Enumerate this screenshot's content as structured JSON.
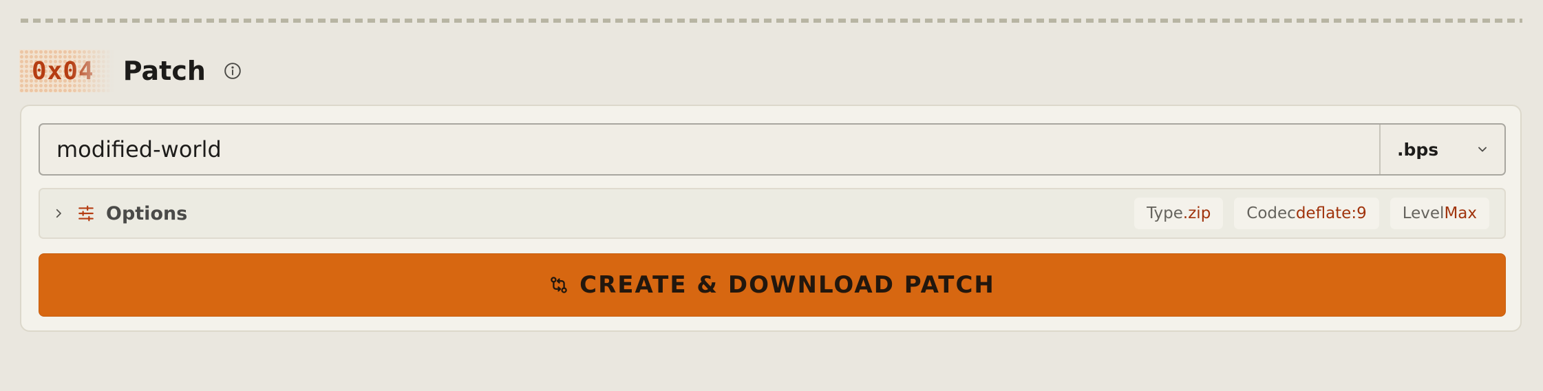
{
  "step": {
    "number": "0x04",
    "title": "Patch"
  },
  "patch_name": {
    "value": "modified-world",
    "format": ".bps",
    "format_options": [
      ".bps"
    ]
  },
  "options": {
    "label": "Options",
    "chips": [
      {
        "key": "Type",
        "value": ".zip"
      },
      {
        "key": "Codec",
        "value": "deflate:9"
      },
      {
        "key": "Level",
        "value": "Max"
      }
    ]
  },
  "create_button": {
    "label": "CREATE & DOWNLOAD PATCH"
  },
  "colors": {
    "page_bg": "#eae7df",
    "card_bg": "#f4f2eb",
    "accent": "#d76711",
    "accent_text": "#b53d12",
    "chip_value": "#a0340d"
  },
  "icons": {
    "info": "info-icon",
    "select": "chevron-down-icon",
    "expand": "chevron-right-icon",
    "options": "sliders-icon",
    "create": "git-compare-icon"
  }
}
